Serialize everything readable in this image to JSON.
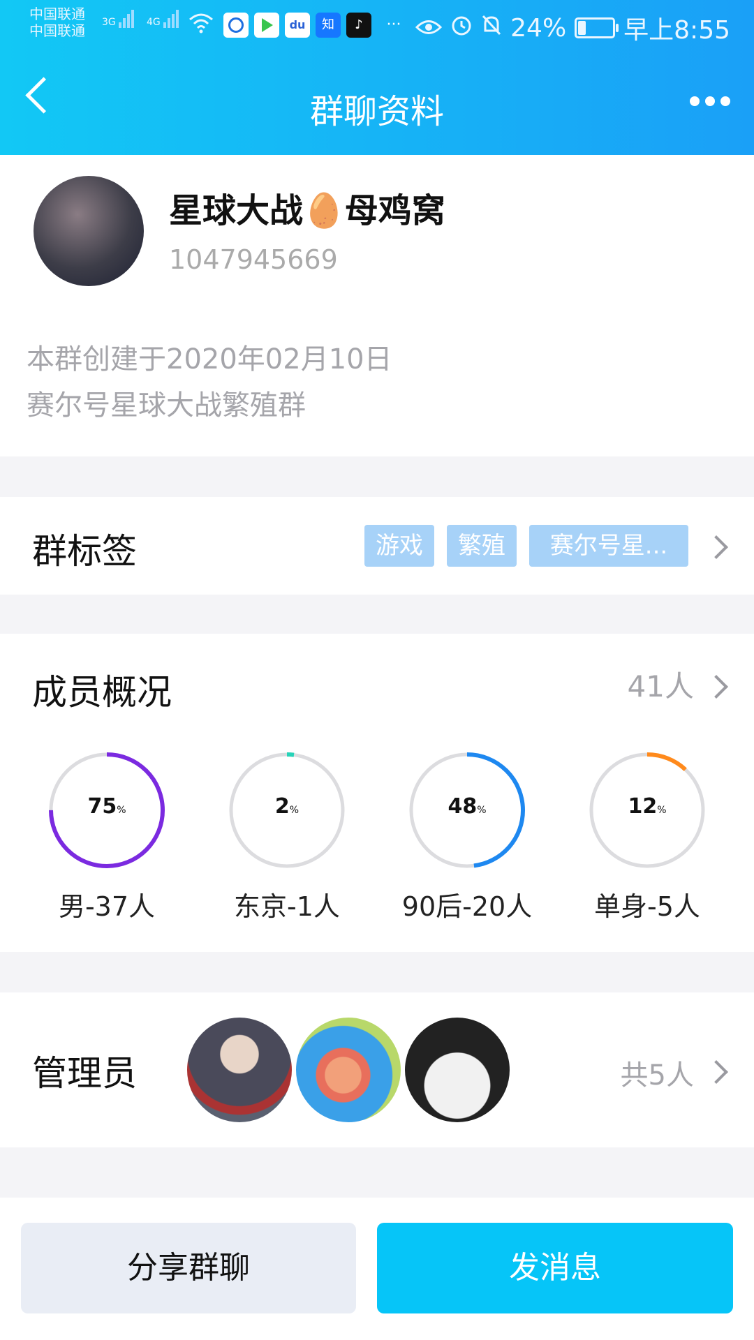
{
  "status_bar": {
    "carrier1": "中国联通",
    "carrier2": "中国联通",
    "net1": "3G",
    "net2": "4G",
    "app_zhihu": "知",
    "ellipsis": "···",
    "battery": "24%",
    "time": "早上8:55",
    "battery_level": 0.24
  },
  "header": {
    "title": "群聊资料"
  },
  "profile": {
    "name": "星球大战🥚母鸡窝",
    "id": "1047945669",
    "desc_line1": "本群创建于2020年02月10日",
    "desc_line2": "赛尔号星球大战繁殖群"
  },
  "tags": {
    "label": "群标签",
    "items": [
      "游戏",
      "繁殖",
      "赛尔号星..."
    ]
  },
  "members": {
    "label": "成员概况",
    "count": "41人",
    "stats": [
      {
        "pct": "75",
        "unit": "%",
        "label": "男-37人",
        "value": 0.75,
        "color": "#7b2ae0"
      },
      {
        "pct": "2",
        "unit": "%",
        "label": "东京-1人",
        "value": 0.02,
        "color": "#27d3b8"
      },
      {
        "pct": "48",
        "unit": "%",
        "label": "90后-20人",
        "value": 0.48,
        "color": "#1e88f0"
      },
      {
        "pct": "12",
        "unit": "%",
        "label": "单身-5人",
        "value": 0.12,
        "color": "#ff8a1c"
      }
    ]
  },
  "admins": {
    "label": "管理员",
    "count": "共5人"
  },
  "footer": {
    "share": "分享群聊",
    "send": "发消息"
  }
}
